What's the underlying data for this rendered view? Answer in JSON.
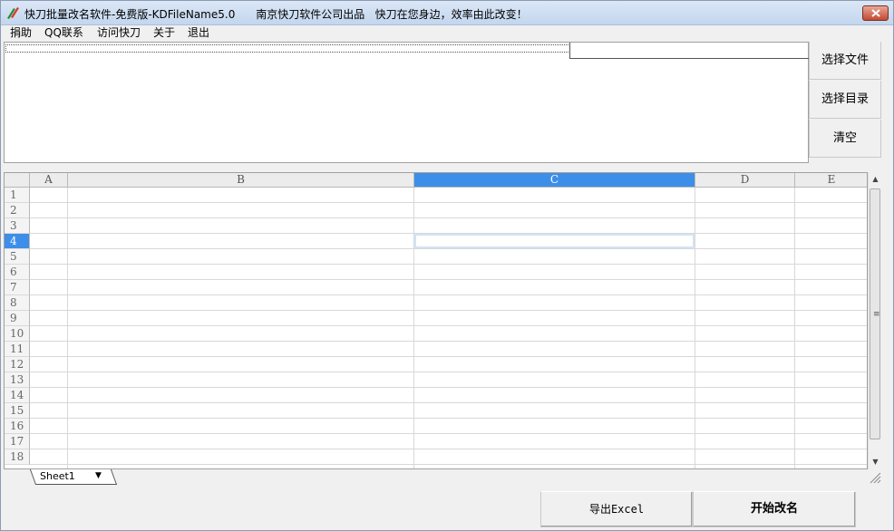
{
  "window": {
    "title": "快刀批量改名软件-免费版-KDFileName5.0      南京快刀软件公司出品   快刀在您身边，效率由此改变！"
  },
  "menu": [
    "捐助",
    "QQ联系",
    "访问快刀",
    "关于",
    "退出"
  ],
  "side_buttons": {
    "select_file": "选择文件",
    "select_dir": "选择目录",
    "clear": "清空"
  },
  "grid": {
    "columns": [
      "A",
      "B",
      "C",
      "D",
      "E"
    ],
    "selected_column": "C",
    "rows": [
      "1",
      "2",
      "3",
      "4",
      "5",
      "6",
      "7",
      "8",
      "9",
      "10",
      "11",
      "12",
      "13",
      "14",
      "15",
      "16",
      "17",
      "18"
    ],
    "selected_row": "4"
  },
  "sheet": {
    "tab": "Sheet1"
  },
  "bottom_buttons": {
    "export": "导出Excel",
    "start": "开始改名"
  },
  "colors": {
    "selection": "#3d8ee8",
    "close_button": "#c24a33"
  }
}
